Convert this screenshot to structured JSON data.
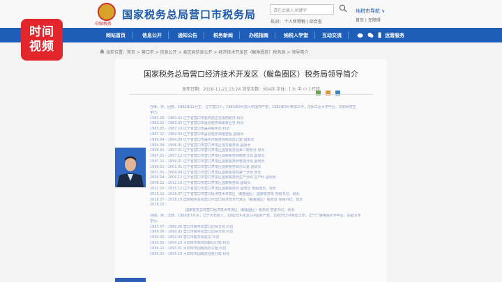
{
  "watermark": {
    "line1": "时间",
    "line2": "视频"
  },
  "header": {
    "emblem_caption": "中国税务",
    "title": "国家税务总局营口市税务局",
    "search_placeholder": "请在此输入关键字",
    "hot_words": "热词： 个人所得税 | 综合查",
    "nav_guide": "地税市导航 ∨",
    "nav_guide_sub": "首页 | 无障碍"
  },
  "nav": {
    "items": [
      "网站首页",
      "信息公开",
      "通知公告",
      "税务新闻",
      "办税指南",
      "纳税人学堂",
      "互动交流",
      "运营服务"
    ]
  },
  "breadcrumb": "当前位置：首页 > 营口市 > 信息公开 > 县区局信息公开 > 经济技术开发区（鲅鱼圈区）税务局 > 领导简介",
  "article": {
    "title": "国家税务总局营口经济技术开发区（鲅鱼圈区）税务局领导简介",
    "meta": "发布日期：2018-11-21 15:24  浏览次数：604次  字体：[ 大 中 小 ]  打印"
  },
  "bio_lines": [
    "任维，男，回族，1962年11月生，辽宁营口人，1983年9月加入中国共产党，1982年9月参加工作，沈阳工业大学毕业，在职研究生",
    "学历。",
    "1982.09 - 1983.02  辽宁省营口市税务局正式录用职员 科员",
    "1983.02 - 1983.05  辽宁省营口市盖县税务局税收业务 科员",
    "1983.05 - 1987.10  辽宁省营口市盖县税务局 科员",
    "1987.10 - 1989.04  辽宁省营口市盖县税务局稽查股 副股长",
    "1989.04 - 1994.09  辽宁省营口市盖州市税务局税政办公室 副局长",
    "1994.09 - 1996.01  辽宁省营口市营口开发区地方税务局 副局长",
    "1996.01 - 1997.01  辽宁省营口市营口开发区国家税务局第二税务分 局长",
    "1997.01 - 1997.12  辽宁省营口市营口开发区国家税务局稽查分局 副局长",
    "1997.12 - 1999.01  辽宁省营口市营口开发区国家税务局管理分局 副局长",
    "1999.01 - 2001.01  辽宁省营口市营口开发区国家税务局办公室 副局长",
    "2001.01 - 2004.04  辽宁省营口市营口开发区国家税务局第一分局 局长",
    "2004.04 - 2006.12  辽宁省营口市营口开发区国家税务局生产分局 生产科 副局长",
    "2006.12 - 2012.10  辽宁省营口市营口开发区国家税务局 副局长",
    "2012.10 - 2015.12  辽宁省营口市营口开发区国家税务局 副局长  党组成员、局长",
    "2015.12 - 2018.07  辽宁省营口市营口经济技术开发区（鲅鱼圈区）国家税务局 党组书记、局长",
    "2018.07 - 2018.10  国家税务总局营口市营口经济技术开发区（鲅鱼圈区）税务局 党组书记、局长",
    "2018.10 -",
    "国家税务总局营口经济技术开发区（鲅鱼圈区）税务局 党委书记、局长",
    "孙刚，男，汉族，1966年7月生，辽宁大石桥人，1992年4月加入中国共产党，1987年7月参加工作，辽宁广播电视大学毕业，在职大专",
    "学历。",
    "1987.07 - 1989.06  营口市税务局营口边贸分局 科员",
    "1989.06 - 1990.02  营口市税务局营口边贸分局 科员",
    "1990.02 - 1992.02  营口市税务局机关 科员",
    "1992.02 - 1994.10  大石桥市税务局鞍山分局 科员",
    "1994.10 - 1995.01  大石桥市国税局办公室 科员",
    "1995.01 - 1995.10  大石桥市国税局征收分局 科长"
  ]
}
